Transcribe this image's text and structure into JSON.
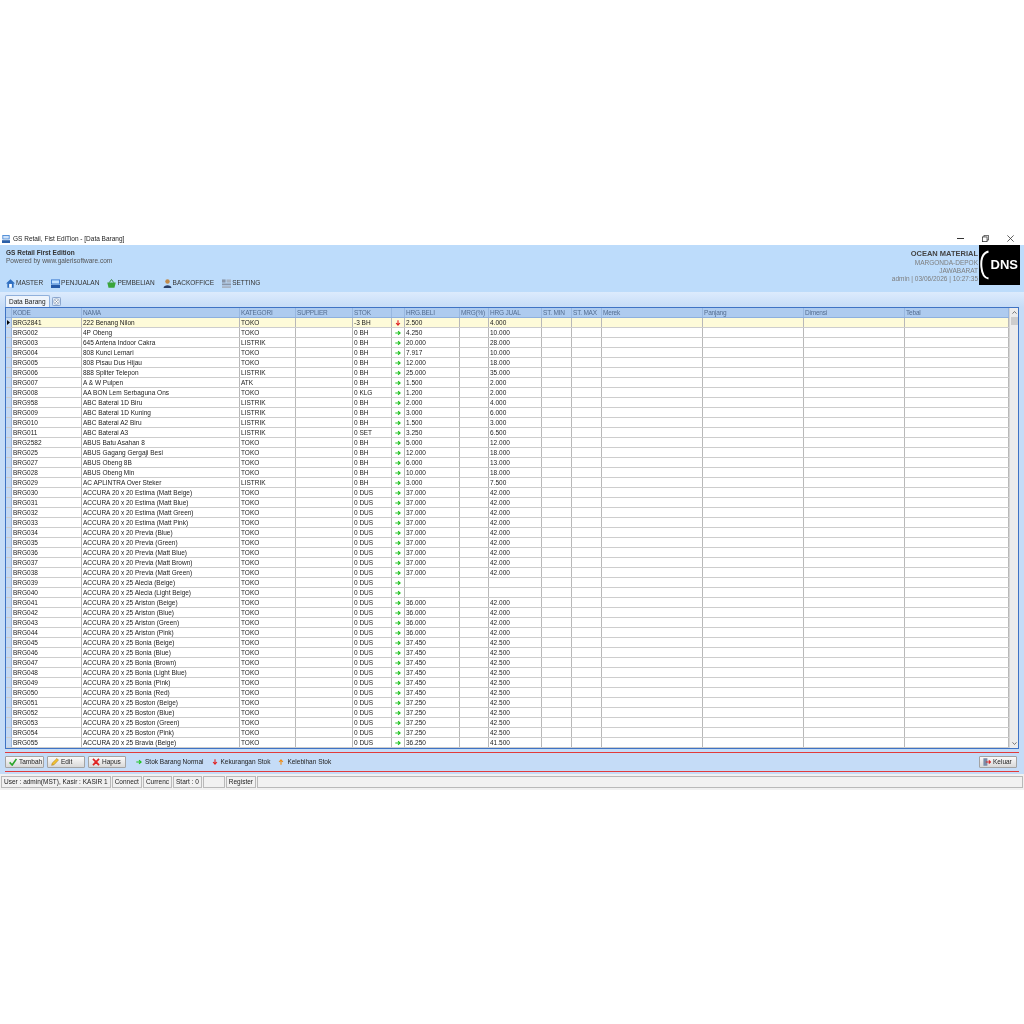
{
  "window": {
    "title": "GS Retail, Fist EdiTion - [Data Barang]"
  },
  "header": {
    "app_name": "GS Retail First Edition",
    "powered_by": "Powered by www.galerisoftware.com",
    "company": {
      "name": "OCEAN MATERIAL",
      "lines": [
        "MARGONDA-DEPOK",
        "JAWABARAT",
        "admin | 03/06/2026 | 10:27:35"
      ],
      "logo_text": "DNS"
    }
  },
  "menu": [
    {
      "label": "MASTER"
    },
    {
      "label": "PENJUALAN"
    },
    {
      "label": "PEMBELIAN"
    },
    {
      "label": "BACKOFFICE"
    },
    {
      "label": "SETTING"
    }
  ],
  "tabs": [
    {
      "label": "Data Barang",
      "selected": true
    }
  ],
  "table": {
    "columns": [
      {
        "kind": "text",
        "label": "KODE"
      },
      {
        "kind": "text",
        "label": "NAMA"
      },
      {
        "kind": "text",
        "label": "KATEGORI"
      },
      {
        "kind": "text",
        "label": "SUPPLIER"
      },
      {
        "kind": "text",
        "label": "STOK"
      },
      {
        "kind": "status"
      },
      {
        "kind": "text",
        "label": "HRG.BELI"
      },
      {
        "kind": "text",
        "label": "MRG(%)"
      },
      {
        "kind": "text",
        "label": "HRG JUAL"
      },
      {
        "kind": "text",
        "label": "ST. MIN"
      },
      {
        "kind": "text",
        "label": "ST. MAX"
      },
      {
        "kind": "text",
        "label": "Merek"
      },
      {
        "kind": "text",
        "label": "Panjang"
      },
      {
        "kind": "text",
        "label": "Dimensi"
      },
      {
        "kind": "text",
        "label": "Tebal"
      }
    ],
    "rows": [
      {
        "selected": true,
        "kode": "BRG2841",
        "nama": "222 Benang Nilon",
        "kategori": "TOKO",
        "stok": "-3 BH",
        "low_stock": true,
        "hrg_beli": "2.500",
        "hrg_jual": "4.000"
      },
      {
        "selected": false,
        "kode": "BRG002",
        "nama": "4P Obeng",
        "kategori": "TOKO",
        "stok": "0 BH",
        "low_stock": false,
        "hrg_beli": "4.250",
        "hrg_jual": "10.000"
      },
      {
        "selected": false,
        "kode": "BRG003",
        "nama": "645 Antena Indoor Cakra",
        "kategori": "LISTRIK",
        "stok": "0 BH",
        "low_stock": false,
        "hrg_beli": "20.000",
        "hrg_jual": "28.000"
      },
      {
        "selected": false,
        "kode": "BRG004",
        "nama": "808 Kunci Lemari",
        "kategori": "TOKO",
        "stok": "0 BH",
        "low_stock": false,
        "hrg_beli": "7.917",
        "hrg_jual": "10.000"
      },
      {
        "selected": false,
        "kode": "BRG005",
        "nama": "808 Pisau Dus Hijau",
        "kategori": "TOKO",
        "stok": "0 BH",
        "low_stock": false,
        "hrg_beli": "12.000",
        "hrg_jual": "18.000"
      },
      {
        "selected": false,
        "kode": "BRG006",
        "nama": "888 Spliter Telepon",
        "kategori": "LISTRIK",
        "stok": "0 BH",
        "low_stock": false,
        "hrg_beli": "25.000",
        "hrg_jual": "35.000"
      },
      {
        "selected": false,
        "kode": "BRG007",
        "nama": "A & W Pulpen",
        "kategori": "ATK",
        "stok": "0 BH",
        "low_stock": false,
        "hrg_beli": "1.500",
        "hrg_jual": "2.000"
      },
      {
        "selected": false,
        "kode": "BRG008",
        "nama": "AA BON Lem Serbaguna Ons",
        "kategori": "TOKO",
        "stok": "0 KLG",
        "low_stock": false,
        "hrg_beli": "1.200",
        "hrg_jual": "2.000"
      },
      {
        "selected": false,
        "kode": "BRG958",
        "nama": "ABC Baterai 1D Biru",
        "kategori": "LISTRIK",
        "stok": "0 BH",
        "low_stock": false,
        "hrg_beli": "2.000",
        "hrg_jual": "4.000"
      },
      {
        "selected": false,
        "kode": "BRG009",
        "nama": "ABC Baterai 1D Kuning",
        "kategori": "LISTRIK",
        "stok": "0 BH",
        "low_stock": false,
        "hrg_beli": "3.000",
        "hrg_jual": "6.000"
      },
      {
        "selected": false,
        "kode": "BRG010",
        "nama": "ABC Baterai A2 Biru",
        "kategori": "LISTRIK",
        "stok": "0 BH",
        "low_stock": false,
        "hrg_beli": "1.500",
        "hrg_jual": "3.000"
      },
      {
        "selected": false,
        "kode": "BRG011",
        "nama": "ABC Baterai A3",
        "kategori": "LISTRIK",
        "stok": "0 SET",
        "low_stock": false,
        "hrg_beli": "3.250",
        "hrg_jual": "6.500"
      },
      {
        "selected": false,
        "kode": "BRG2582",
        "nama": "ABUS Batu Asahan 8",
        "kategori": "TOKO",
        "stok": "0 BH",
        "low_stock": false,
        "hrg_beli": "5.000",
        "hrg_jual": "12.000"
      },
      {
        "selected": false,
        "kode": "BRG025",
        "nama": "ABUS Gagang Gergaji Besi",
        "kategori": "TOKO",
        "stok": "0 BH",
        "low_stock": false,
        "hrg_beli": "12.000",
        "hrg_jual": "18.000"
      },
      {
        "selected": false,
        "kode": "BRG027",
        "nama": "ABUS Obeng 8B",
        "kategori": "TOKO",
        "stok": "0 BH",
        "low_stock": false,
        "hrg_beli": "6.000",
        "hrg_jual": "13.000"
      },
      {
        "selected": false,
        "kode": "BRG028",
        "nama": "ABUS Obeng Min",
        "kategori": "TOKO",
        "stok": "0 BH",
        "low_stock": false,
        "hrg_beli": "10.000",
        "hrg_jual": "18.000"
      },
      {
        "selected": false,
        "kode": "BRG029",
        "nama": "AC APLINTRA Over Steker",
        "kategori": "LISTRIK",
        "stok": "0 BH",
        "low_stock": false,
        "hrg_beli": "3.000",
        "hrg_jual": "7.500"
      },
      {
        "selected": false,
        "kode": "BRG030",
        "nama": "ACCURA 20 x 20 Estima (Matt Beige)",
        "kategori": "TOKO",
        "stok": "0 DUS",
        "low_stock": false,
        "hrg_beli": "37.000",
        "hrg_jual": "42.000"
      },
      {
        "selected": false,
        "kode": "BRG031",
        "nama": "ACCURA 20 x 20 Estima (Matt Blue)",
        "kategori": "TOKO",
        "stok": "0 DUS",
        "low_stock": false,
        "hrg_beli": "37.000",
        "hrg_jual": "42.000"
      },
      {
        "selected": false,
        "kode": "BRG032",
        "nama": "ACCURA 20 x 20 Estima (Matt Green)",
        "kategori": "TOKO",
        "stok": "0 DUS",
        "low_stock": false,
        "hrg_beli": "37.000",
        "hrg_jual": "42.000"
      },
      {
        "selected": false,
        "kode": "BRG033",
        "nama": "ACCURA 20 x 20 Estima (Matt Pink)",
        "kategori": "TOKO",
        "stok": "0 DUS",
        "low_stock": false,
        "hrg_beli": "37.000",
        "hrg_jual": "42.000"
      },
      {
        "selected": false,
        "kode": "BRG034",
        "nama": "ACCURA 20 x 20 Previa (Blue)",
        "kategori": "TOKO",
        "stok": "0 DUS",
        "low_stock": false,
        "hrg_beli": "37.000",
        "hrg_jual": "42.000"
      },
      {
        "selected": false,
        "kode": "BRG035",
        "nama": "ACCURA 20 x 20 Previa (Green)",
        "kategori": "TOKO",
        "stok": "0 DUS",
        "low_stock": false,
        "hrg_beli": "37.000",
        "hrg_jual": "42.000"
      },
      {
        "selected": false,
        "kode": "BRG036",
        "nama": "ACCURA 20 x 20 Previa (Matt Blue)",
        "kategori": "TOKO",
        "stok": "0 DUS",
        "low_stock": false,
        "hrg_beli": "37.000",
        "hrg_jual": "42.000"
      },
      {
        "selected": false,
        "kode": "BRG037",
        "nama": "ACCURA 20 x 20 Previa (Matt Brown)",
        "kategori": "TOKO",
        "stok": "0 DUS",
        "low_stock": false,
        "hrg_beli": "37.000",
        "hrg_jual": "42.000"
      },
      {
        "selected": false,
        "kode": "BRG038",
        "nama": "ACCURA 20 x 20 Previa (Matt Green)",
        "kategori": "TOKO",
        "stok": "0 DUS",
        "low_stock": false,
        "hrg_beli": "37.000",
        "hrg_jual": "42.000"
      },
      {
        "selected": false,
        "kode": "BRG039",
        "nama": "ACCURA 20 x 25 Alecia (Beige)",
        "kategori": "TOKO",
        "stok": "0 DUS",
        "low_stock": false
      },
      {
        "selected": false,
        "kode": "BRG040",
        "nama": "ACCURA 20 x 25 Alecia (Light Beige)",
        "kategori": "TOKO",
        "stok": "0 DUS",
        "low_stock": false
      },
      {
        "selected": false,
        "kode": "BRG041",
        "nama": "ACCURA 20 x 25 Ariston (Beige)",
        "kategori": "TOKO",
        "stok": "0 DUS",
        "low_stock": false,
        "hrg_beli": "36.000",
        "hrg_jual": "42.000"
      },
      {
        "selected": false,
        "kode": "BRG042",
        "nama": "ACCURA 20 x 25 Ariston (Blue)",
        "kategori": "TOKO",
        "stok": "0 DUS",
        "low_stock": false,
        "hrg_beli": "36.000",
        "hrg_jual": "42.000"
      },
      {
        "selected": false,
        "kode": "BRG043",
        "nama": "ACCURA 20 x 25 Ariston (Green)",
        "kategori": "TOKO",
        "stok": "0 DUS",
        "low_stock": false,
        "hrg_beli": "36.000",
        "hrg_jual": "42.000"
      },
      {
        "selected": false,
        "kode": "BRG044",
        "nama": "ACCURA 20 x 25 Ariston (Pink)",
        "kategori": "TOKO",
        "stok": "0 DUS",
        "low_stock": false,
        "hrg_beli": "36.000",
        "hrg_jual": "42.000"
      },
      {
        "selected": false,
        "kode": "BRG045",
        "nama": "ACCURA 20 x 25 Bonia (Beige)",
        "kategori": "TOKO",
        "stok": "0 DUS",
        "low_stock": false,
        "hrg_beli": "37.450",
        "hrg_jual": "42.500"
      },
      {
        "selected": false,
        "kode": "BRG046",
        "nama": "ACCURA 20 x 25 Bonia (Blue)",
        "kategori": "TOKO",
        "stok": "0 DUS",
        "low_stock": false,
        "hrg_beli": "37.450",
        "hrg_jual": "42.500"
      },
      {
        "selected": false,
        "kode": "BRG047",
        "nama": "ACCURA 20 x 25 Bonia (Brown)",
        "kategori": "TOKO",
        "stok": "0 DUS",
        "low_stock": false,
        "hrg_beli": "37.450",
        "hrg_jual": "42.500"
      },
      {
        "selected": false,
        "kode": "BRG048",
        "nama": "ACCURA 20 x 25 Bonia (Light Blue)",
        "kategori": "TOKO",
        "stok": "0 DUS",
        "low_stock": false,
        "hrg_beli": "37.450",
        "hrg_jual": "42.500"
      },
      {
        "selected": false,
        "kode": "BRG049",
        "nama": "ACCURA 20 x 25 Bonia (Pink)",
        "kategori": "TOKO",
        "stok": "0 DUS",
        "low_stock": false,
        "hrg_beli": "37.450",
        "hrg_jual": "42.500"
      },
      {
        "selected": false,
        "kode": "BRG050",
        "nama": "ACCURA 20 x 25 Bonia (Red)",
        "kategori": "TOKO",
        "stok": "0 DUS",
        "low_stock": false,
        "hrg_beli": "37.450",
        "hrg_jual": "42.500"
      },
      {
        "selected": false,
        "kode": "BRG051",
        "nama": "ACCURA 20 x 25 Boston (Beige)",
        "kategori": "TOKO",
        "stok": "0 DUS",
        "low_stock": false,
        "hrg_beli": "37.250",
        "hrg_jual": "42.500"
      },
      {
        "selected": false,
        "kode": "BRG052",
        "nama": "ACCURA 20 x 25 Boston (Blue)",
        "kategori": "TOKO",
        "stok": "0 DUS",
        "low_stock": false,
        "hrg_beli": "37.250",
        "hrg_jual": "42.500"
      },
      {
        "selected": false,
        "kode": "BRG053",
        "nama": "ACCURA 20 x 25 Boston (Green)",
        "kategori": "TOKO",
        "stok": "0 DUS",
        "low_stock": false,
        "hrg_beli": "37.250",
        "hrg_jual": "42.500"
      },
      {
        "selected": false,
        "kode": "BRG054",
        "nama": "ACCURA 20 x 25 Boston (Pink)",
        "kategori": "TOKO",
        "stok": "0 DUS",
        "low_stock": false,
        "hrg_beli": "37.250",
        "hrg_jual": "42.500"
      },
      {
        "selected": false,
        "kode": "BRG055",
        "nama": "ACCURA 20 x 25 Bravia (Beige)",
        "kategori": "TOKO",
        "stok": "0 DUS",
        "low_stock": false,
        "hrg_beli": "36.250",
        "hrg_jual": "41.500"
      }
    ]
  },
  "toolbar": {
    "buttons": [
      {
        "label": "Tambah"
      },
      {
        "label": "Edit"
      },
      {
        "label": "Hapus"
      }
    ],
    "legend": [
      {
        "kind": "normal",
        "label": "Stok Barang Normal"
      },
      {
        "kind": "low",
        "label": "Kekurangan Stok"
      },
      {
        "kind": "over",
        "label": "Kelebihan Stok"
      }
    ],
    "exit_button": {
      "label": "Keluar"
    }
  },
  "status_bar": [
    "User : admin(MST), Kasir : KASIR 1",
    "Connect",
    "Currenc",
    "Start : 0",
    "Register"
  ]
}
